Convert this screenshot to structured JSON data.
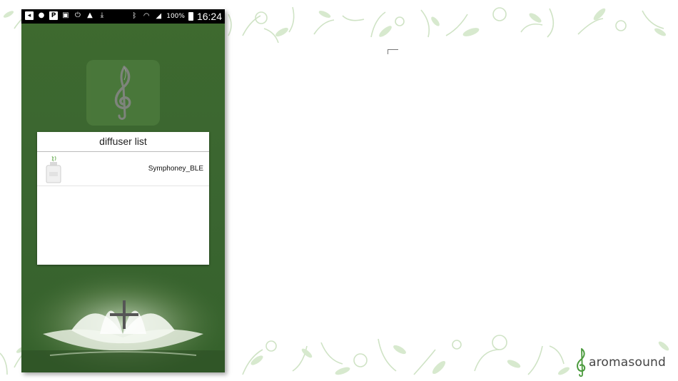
{
  "status_bar": {
    "battery_percent": "100%",
    "time": "16:24",
    "icons_left": [
      "back-icon",
      "navigation-icon",
      "p-icon",
      "image-icon",
      "power-icon",
      "warning-icon",
      "download-icon"
    ],
    "icons_right": [
      "bluetooth-icon",
      "wifi-icon",
      "signal-icon",
      "battery-icon"
    ]
  },
  "app": {
    "logo_icon": "treble-clef-leaf-icon",
    "add_icon": "plus-icon"
  },
  "dialog": {
    "title": "diffuser list",
    "devices": [
      {
        "name": "Symphoney_BLE",
        "icon": "diffuser-bottle-icon"
      }
    ]
  },
  "brand": {
    "name": "aromasound",
    "color": "#444444",
    "accent": "#4a9a3c"
  },
  "colors": {
    "app_background": "#3b672e",
    "decor_leaf": "#c9dfbf"
  }
}
